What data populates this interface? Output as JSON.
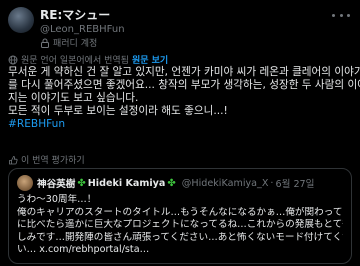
{
  "author": {
    "display_name": "RE:マシュー",
    "handle": "@Leon_REBHFun",
    "account_type": "패러디 계정"
  },
  "translation": {
    "label": "원문 언어 일본어에서 번역됨",
    "show_original": "원문 보기"
  },
  "post": {
    "lines": [
      "무서운 게 약하신 건 잘 알고 있지만, 언젠가 카미야 씨가 레온과 클레어의 이야기",
      "를 다시 풀어주셨으면 좋겠어요... 창작의 부모가 생각하는, 성장한 두 사람의 이어",
      "지는 이야기도 보고 싶습니다.",
      "모든 적이 두부로 보이는 설정이라 해도 좋으니...!"
    ],
    "hashtag": "#REBHFun"
  },
  "rate_translation": "이 번역 평가하기",
  "quote": {
    "name1": "神谷英樹",
    "name2": "Hideki Kamiya",
    "clover": "✤",
    "handle": "@HidekiKamiya_X",
    "separator": "·",
    "date": "6월 27일",
    "lines": [
      "うわ〜30周年…！",
      "俺のキャリアのスタートのタイトル…もうそんなになるかぁ…俺が関わってた頃",
      "に比べたら遥かに巨大なプロジェクトになってるね…これからの発展もとても楽",
      "しみです…開発陣の皆さん頑張ってください…あと怖くないモード付けてくださ",
      "い… x.com/rebhportal/sta…"
    ]
  },
  "colors": {
    "background": "#000000",
    "text": "#e7e9ea",
    "muted": "#71767b",
    "accent": "#1d9bf0",
    "border": "#2f3336",
    "clover": "#3ec53e"
  }
}
